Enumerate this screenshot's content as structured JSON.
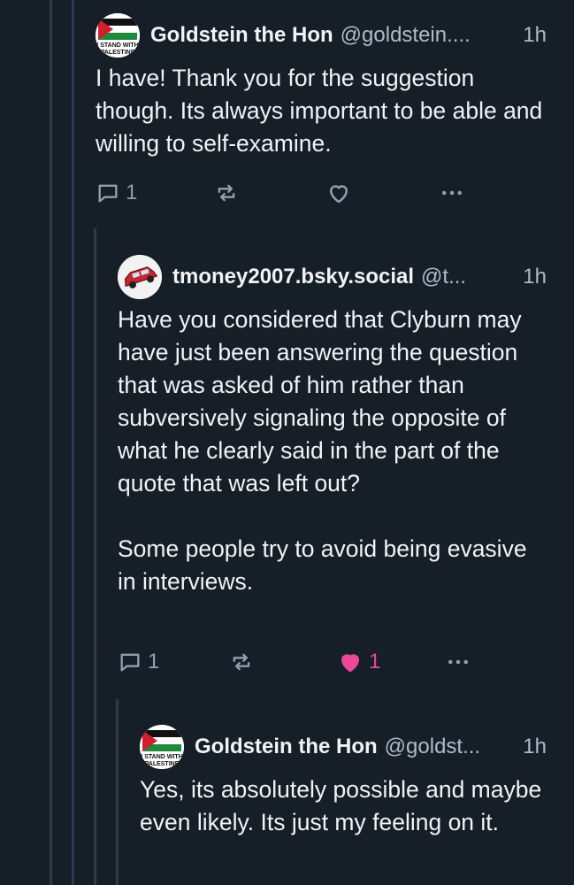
{
  "posts": [
    {
      "author": "Goldstein the Hon",
      "handle": "@goldstein....",
      "time": "1h",
      "avatar_text": [
        "I STAND WITH",
        "PALESTINE"
      ],
      "text": "I have! Thank you for the suggestion though. Its always important to be able and willing to self-examine.",
      "replies": "1",
      "likes": "",
      "liked": false
    },
    {
      "author": "tmoney2007.bsky.social",
      "handle": "@t...",
      "time": "1h",
      "avatar_icon": "red-station-wagon",
      "text": "Have you considered that Clyburn may have just been answering the question that was asked of him rather than subversively signaling the opposite of what he clearly said in the part of the quote that was left out?\n\nSome people try to avoid being evasive in interviews.",
      "replies": "1",
      "likes": "1",
      "liked": true
    },
    {
      "author": "Goldstein the Hon",
      "handle": "@goldst...",
      "time": "1h",
      "avatar_text": [
        "I STAND WITH",
        "PALESTINE"
      ],
      "text": "Yes, its absolutely possible and maybe even likely. Its just my feeling on it."
    }
  ],
  "colors": {
    "background": "#161e27",
    "text": "#f1f3f5",
    "muted": "#aebbc9",
    "icon": "#8fa0b3",
    "like": "#ec4899",
    "thread_line": "#2e3c4a"
  },
  "icons": [
    "reply-icon",
    "repost-icon",
    "like-icon",
    "more-icon"
  ]
}
